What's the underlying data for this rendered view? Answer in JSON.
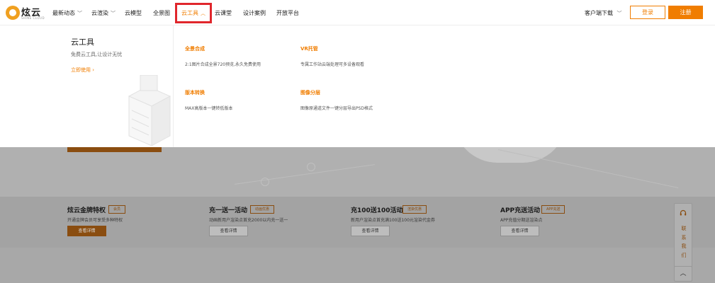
{
  "header": {
    "brand": "炫云",
    "brand_sub": "SHINE CLOUD",
    "nav": [
      {
        "label": "最新动态",
        "chevron": "﹀"
      },
      {
        "label": "云渲染",
        "chevron": "﹀"
      },
      {
        "label": "云模型"
      },
      {
        "label": "全景图"
      },
      {
        "label": "云工具",
        "chevron": "︿"
      },
      {
        "label": "云课堂"
      },
      {
        "label": "设计案例"
      },
      {
        "label": "开放平台"
      }
    ],
    "client_download": "客户端下载",
    "client_chevron": "﹀",
    "login": "登录",
    "register": "注册"
  },
  "dropdown": {
    "title": "云工具",
    "desc": "免费云工具,让设计无忧",
    "link": "立即使用 ›",
    "items": [
      {
        "title": "全景合成",
        "desc": "2:1图片合成全景720预览,永久免费使用"
      },
      {
        "title": "VR托管",
        "desc": "专属工作站云端处理可多设备观看"
      },
      {
        "title": "版本转换",
        "desc": "MAX高版本一键转低版本"
      },
      {
        "title": "图像分层",
        "desc": "图像原通道文件一键分层导出PSD格式"
      }
    ]
  },
  "promos": [
    {
      "title": "炫云金牌特权",
      "badge": "会员",
      "desc": "开通金牌会员可享受多种特权",
      "button": "查看详情"
    },
    {
      "title": "充一送一活动",
      "badge": "动画优惠",
      "desc": "动画新用户渲染点首充2000以内充一送一",
      "button": "查看详情"
    },
    {
      "title": "充100送100活动",
      "badge": "渲染优惠",
      "desc": "新用户渲染点首充满100送100元渲染代金券",
      "button": "查看详情"
    },
    {
      "title": "APP充送活动",
      "badge": "APP充送",
      "desc": "APP充值分期送渲染点",
      "button": "查看详情"
    }
  ],
  "float_widget": {
    "icon": "headset-icon",
    "text": [
      "联",
      "系",
      "我",
      "们"
    ],
    "back_top": "︿"
  },
  "colors": {
    "accent": "#f07d00",
    "highlight": "#e0262c",
    "overlay_gray": "#a8a8a8"
  }
}
